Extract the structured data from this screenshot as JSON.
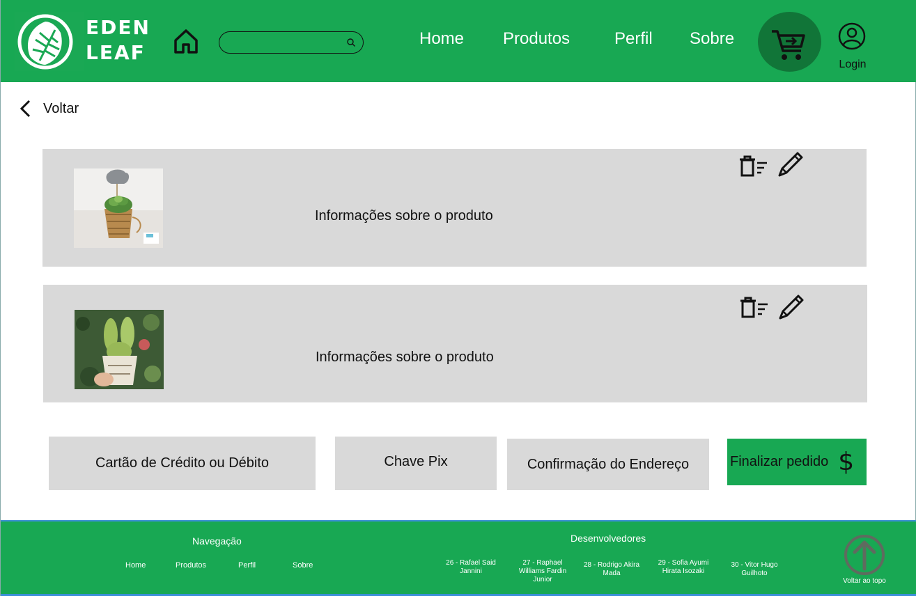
{
  "brand": {
    "line1": "EDEN",
    "line2": "LEAF",
    "color": "#18a853"
  },
  "header": {
    "nav": [
      "Home",
      "Produtos",
      "Perfil",
      "Sobre"
    ],
    "login_label": "Login",
    "icons": {
      "home": "home-icon",
      "search": "search-icon",
      "cart": "cart-icon",
      "user": "user-icon"
    }
  },
  "search": {
    "placeholder": ""
  },
  "back_label": "Voltar",
  "products": [
    {
      "info": "Informações sobre o produto",
      "image": "succulent-in-burlap-pot"
    },
    {
      "info": "Informações sobre o produto",
      "image": "bunny-ear-cactus-in-pot"
    }
  ],
  "payment": {
    "card": "Cartão de Crédito ou Débito",
    "pix": "Chave Pix",
    "address": "Confirmação do Endereço",
    "finish": "Finalizar pedido",
    "currency_symbol": "$"
  },
  "footer": {
    "nav_title": "Navegação",
    "nav_links": [
      "Home",
      "Produtos",
      "Perfil",
      "Sobre"
    ],
    "devs_title": "Desenvolvedores",
    "devs": [
      "26 - Rafael Said Jannini",
      "27 - Raphael Williams Fardin Junior",
      "28 - Rodrigo Akira Mada",
      "29 - Sofia Ayumi Hirata Isozaki",
      "30 - Vitor Hugo Guilhoto"
    ],
    "back_to_top": "Voltar ao topo"
  }
}
